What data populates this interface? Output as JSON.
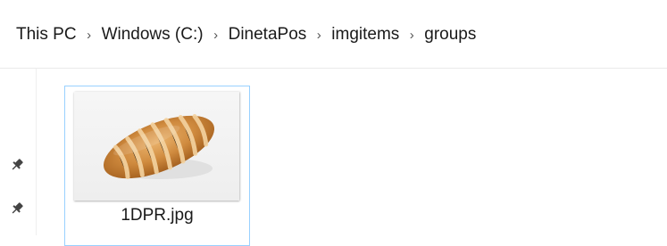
{
  "breadcrumb": {
    "items": [
      "This PC",
      "Windows (C:)",
      "DinetaPos",
      "imgitems",
      "groups"
    ],
    "separator": "›"
  },
  "sidebar": {
    "pins": [
      {
        "icon": "pin-icon"
      },
      {
        "icon": "pin-icon"
      }
    ]
  },
  "files": [
    {
      "name": "1DPR.jpg",
      "icon": "bread-image-thumbnail",
      "selected": true
    }
  ],
  "colors": {
    "selection_border": "#99d1ff"
  }
}
